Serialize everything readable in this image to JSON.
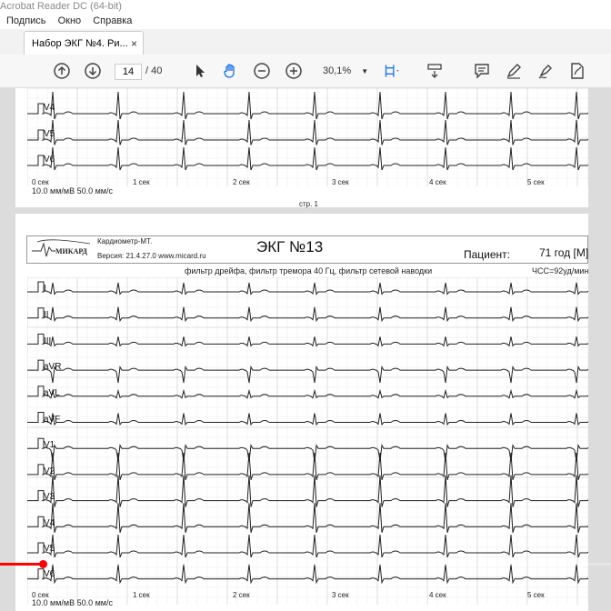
{
  "window": {
    "title": "Acrobat Reader DC (64-bit)"
  },
  "menu": {
    "items": [
      "Подпись",
      "Окно",
      "Справка"
    ]
  },
  "tab": {
    "label": "Набор ЭКГ №4. Ри...",
    "close": "×"
  },
  "toolbar": {
    "page_current": "14",
    "page_total": "/ 40",
    "zoom": "30,1%"
  },
  "prev_page": {
    "leads": [
      "V4",
      "V5",
      "V6"
    ],
    "scale_label": "10.0 мм/мВ 50.0 мм/с",
    "time_marks": [
      "0 сек",
      "1 сек",
      "2 сек",
      "3 сек",
      "4 сек",
      "5 сек"
    ],
    "footer": "стр. 1"
  },
  "page": {
    "logo_text": "МИКАРД",
    "device": "Кардиометр-МТ.",
    "version": "Версия: 21.4.27.0 www.micard.ru",
    "title": "ЭКГ №13",
    "patient_label": "Пациент:",
    "patient_value": "71 год [М]",
    "filters": "фильтр дрейфа, фильтр тремора 40 Гц, фильтр сетевой наводки",
    "hr": "ЧСС=92уд/мин",
    "leads": [
      "I",
      "II",
      "III",
      "aVR",
      "aVL",
      "aVF",
      "V1",
      "V2",
      "V3",
      "V4",
      "V5",
      "V6"
    ],
    "scale_label": "10.0 мм/мВ 50.0 мм/с",
    "time_marks": [
      "0 сек",
      "1 сек",
      "2 сек",
      "3 сек",
      "4 сек",
      "5 сек"
    ]
  },
  "video": {
    "progress": 0.07
  },
  "colors": {
    "grid_major": "#c4c4c4",
    "grid_minor": "#ececec",
    "trace": "#222222",
    "progress": "#ff0000"
  }
}
